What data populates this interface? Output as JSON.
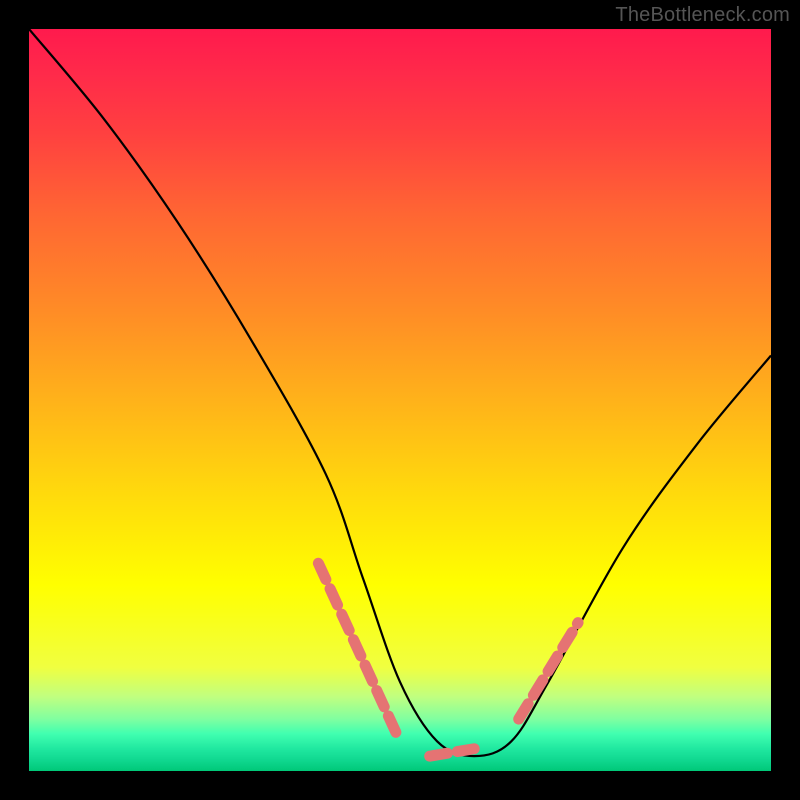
{
  "attribution": "TheBottleneck.com",
  "chart_data": {
    "type": "line",
    "title": "",
    "xlabel": "",
    "ylabel": "",
    "xlim": [
      0,
      100
    ],
    "ylim": [
      0,
      100
    ],
    "series": [
      {
        "name": "bottleneck-curve",
        "x": [
          0,
          10,
          20,
          30,
          40,
          45,
          50,
          55,
          60,
          65,
          70,
          80,
          90,
          100
        ],
        "values": [
          100,
          88,
          74,
          58,
          40,
          26,
          12,
          4,
          2,
          4,
          12,
          30,
          44,
          56
        ]
      }
    ],
    "dotted_segments": [
      {
        "x": [
          39,
          50
        ],
        "y": [
          28,
          4
        ]
      },
      {
        "x": [
          54,
          60
        ],
        "y": [
          2,
          3
        ]
      },
      {
        "x": [
          66,
          74
        ],
        "y": [
          7,
          20
        ]
      }
    ],
    "colors": {
      "curve": "#000000",
      "dots": "#e57373",
      "gradient_top": "#ff1a4d",
      "gradient_bottom": "#00c878"
    }
  }
}
